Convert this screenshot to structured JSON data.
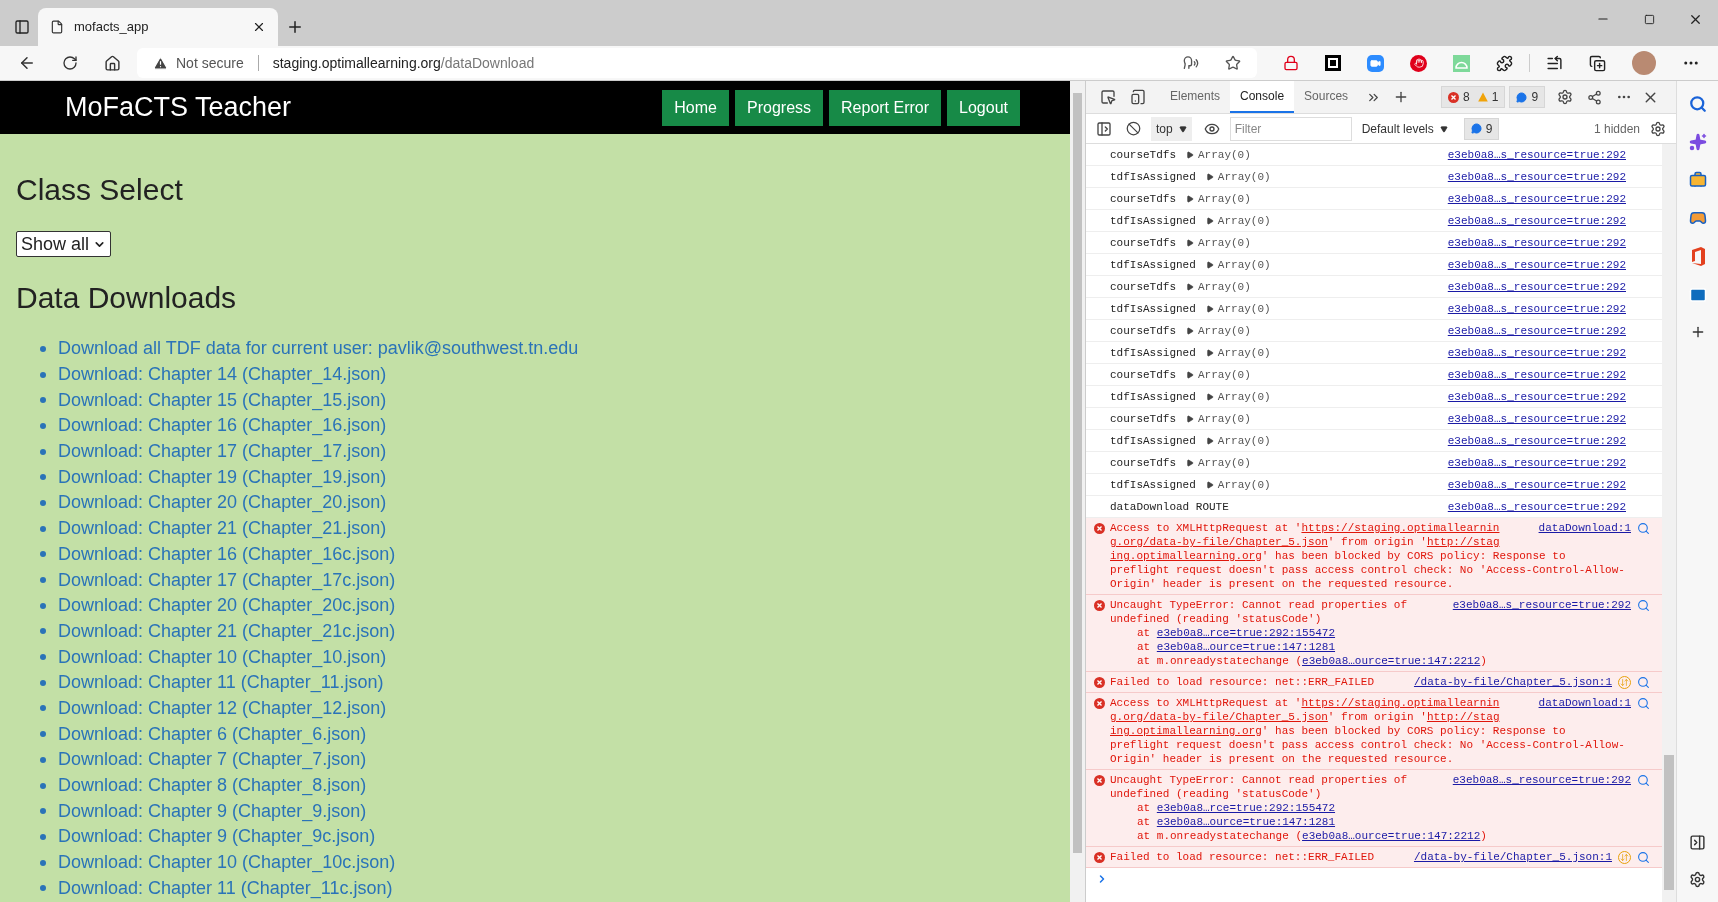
{
  "browser": {
    "tab": {
      "title": "mofacts_app",
      "selected": true
    },
    "address": {
      "security": "Not secure",
      "host": "staging.optimallearning.org",
      "path": "/dataDownload"
    }
  },
  "page": {
    "header": {
      "title": "MoFaCTS Teacher",
      "nav": [
        "Home",
        "Progress",
        "Report Error",
        "Logout"
      ]
    },
    "class_select": {
      "heading": "Class Select",
      "value": "Show all"
    },
    "downloads": {
      "heading": "Data Downloads",
      "links": [
        "Download all TDF data for current user: pavlik@southwest.tn.edu",
        "Download: Chapter 14 (Chapter_14.json)",
        "Download: Chapter 15 (Chapter_15.json)",
        "Download: Chapter 16 (Chapter_16.json)",
        "Download: Chapter 17 (Chapter_17.json)",
        "Download: Chapter 19 (Chapter_19.json)",
        "Download: Chapter 20 (Chapter_20.json)",
        "Download: Chapter 21 (Chapter_21.json)",
        "Download: Chapter 16 (Chapter_16c.json)",
        "Download: Chapter 17 (Chapter_17c.json)",
        "Download: Chapter 20 (Chapter_20c.json)",
        "Download: Chapter 21 (Chapter_21c.json)",
        "Download: Chapter 10 (Chapter_10.json)",
        "Download: Chapter 11 (Chapter_11.json)",
        "Download: Chapter 12 (Chapter_12.json)",
        "Download: Chapter 6 (Chapter_6.json)",
        "Download: Chapter 7 (Chapter_7.json)",
        "Download: Chapter 8 (Chapter_8.json)",
        "Download: Chapter 9 (Chapter_9.json)",
        "Download: Chapter 9 (Chapter_9c.json)",
        "Download: Chapter 10 (Chapter_10c.json)",
        "Download: Chapter 11 (Chapter_11c.json)"
      ]
    }
  },
  "devtools": {
    "tabs": [
      {
        "label": "Elements",
        "selected": false
      },
      {
        "label": "Console",
        "selected": true
      },
      {
        "label": "Sources",
        "selected": false
      }
    ],
    "error_count": "8",
    "warning_count": "1",
    "message_count": "9",
    "context": "top",
    "filter_placeholder": "Filter",
    "levels": "Default levels",
    "level_message_count": "9",
    "hidden": "1 hidden",
    "console": [
      {
        "kind": "log",
        "label": "courseTdfs",
        "value": "Array(0)",
        "source": "e3eb0a8…s_resource=true:292"
      },
      {
        "kind": "log",
        "label": "tdfIsAssigned",
        "value": "Array(0)",
        "source": "e3eb0a8…s_resource=true:292"
      },
      {
        "kind": "log",
        "label": "courseTdfs",
        "value": "Array(0)",
        "source": "e3eb0a8…s_resource=true:292"
      },
      {
        "kind": "log",
        "label": "tdfIsAssigned",
        "value": "Array(0)",
        "source": "e3eb0a8…s_resource=true:292"
      },
      {
        "kind": "log",
        "label": "courseTdfs",
        "value": "Array(0)",
        "source": "e3eb0a8…s_resource=true:292"
      },
      {
        "kind": "log",
        "label": "tdfIsAssigned",
        "value": "Array(0)",
        "source": "e3eb0a8…s_resource=true:292"
      },
      {
        "kind": "log",
        "label": "courseTdfs",
        "value": "Array(0)",
        "source": "e3eb0a8…s_resource=true:292"
      },
      {
        "kind": "log",
        "label": "tdfIsAssigned",
        "value": "Array(0)",
        "source": "e3eb0a8…s_resource=true:292"
      },
      {
        "kind": "log",
        "label": "courseTdfs",
        "value": "Array(0)",
        "source": "e3eb0a8…s_resource=true:292"
      },
      {
        "kind": "log",
        "label": "tdfIsAssigned",
        "value": "Array(0)",
        "source": "e3eb0a8…s_resource=true:292"
      },
      {
        "kind": "log",
        "label": "courseTdfs",
        "value": "Array(0)",
        "source": "e3eb0a8…s_resource=true:292"
      },
      {
        "kind": "log",
        "label": "tdfIsAssigned",
        "value": "Array(0)",
        "source": "e3eb0a8…s_resource=true:292"
      },
      {
        "kind": "log",
        "label": "courseTdfs",
        "value": "Array(0)",
        "source": "e3eb0a8…s_resource=true:292"
      },
      {
        "kind": "log",
        "label": "tdfIsAssigned",
        "value": "Array(0)",
        "source": "e3eb0a8…s_resource=true:292"
      },
      {
        "kind": "log",
        "label": "courseTdfs",
        "value": "Array(0)",
        "source": "e3eb0a8…s_resource=true:292"
      },
      {
        "kind": "log",
        "label": "tdfIsAssigned",
        "value": "Array(0)",
        "source": "e3eb0a8…s_resource=true:292"
      },
      {
        "kind": "text",
        "label": "dataDownload ROUTE",
        "source": "e3eb0a8…s_resource=true:292"
      },
      {
        "kind": "error",
        "lines": [
          [
            {
              "text": "Access to XMLHttpRequest at '",
              "link": false
            },
            {
              "text": "https://staging.optimallearnin",
              "link": true
            }
          ],
          [
            {
              "text": "g.org/data-by-file/Chapter_5.json",
              "link": true
            },
            {
              "text": "' from origin '",
              "link": false
            },
            {
              "text": "http://stag",
              "link": true
            }
          ],
          [
            {
              "text": "ing.optimallearning.org",
              "link": true
            },
            {
              "text": "' has been blocked by CORS policy: Response to",
              "link": false
            }
          ],
          [
            {
              "text": "preflight request doesn't pass access control check: No 'Access-Control-Allow-",
              "link": false
            }
          ],
          [
            {
              "text": "Origin' header is present on the requested resource.",
              "link": false
            }
          ]
        ],
        "source": "dataDownload:1",
        "network": false
      },
      {
        "kind": "error",
        "lines": [
          [
            {
              "text": "Uncaught TypeError: Cannot read properties of",
              "link": false
            }
          ],
          [
            {
              "text": "undefined (reading 'statusCode')",
              "link": false
            }
          ]
        ],
        "stack": [
          [
            {
              "text": "at ",
              "link": false
            },
            {
              "text": "e3eb0a8…rce=true:292:155472",
              "link": true
            }
          ],
          [
            {
              "text": "at ",
              "link": false
            },
            {
              "text": "e3eb0a8…ource=true:147:1281",
              "link": true
            }
          ],
          [
            {
              "text": "at m.onreadystatechange (",
              "link": false
            },
            {
              "text": "e3eb0a8…ource=true:147:2212",
              "link": true
            },
            {
              "text": ")",
              "link": false
            }
          ]
        ],
        "source": "e3eb0a8…s_resource=true:292",
        "network": false
      },
      {
        "kind": "error",
        "lines": [
          [
            {
              "text": "Failed to load resource: net::ERR_FAILED",
              "link": false
            }
          ]
        ],
        "source": "/data-by-file/Chapter_5.json:1",
        "network": true
      },
      {
        "kind": "error",
        "lines": [
          [
            {
              "text": "Access to XMLHttpRequest at '",
              "link": false
            },
            {
              "text": "https://staging.optimallearnin",
              "link": true
            }
          ],
          [
            {
              "text": "g.org/data-by-file/Chapter_5.json",
              "link": true
            },
            {
              "text": "' from origin '",
              "link": false
            },
            {
              "text": "http://stag",
              "link": true
            }
          ],
          [
            {
              "text": "ing.optimallearning.org",
              "link": true
            },
            {
              "text": "' has been blocked by CORS policy: Response to",
              "link": false
            }
          ],
          [
            {
              "text": "preflight request doesn't pass access control check: No 'Access-Control-Allow-",
              "link": false
            }
          ],
          [
            {
              "text": "Origin' header is present on the requested resource.",
              "link": false
            }
          ]
        ],
        "source": "dataDownload:1",
        "network": false
      },
      {
        "kind": "error",
        "lines": [
          [
            {
              "text": "Uncaught TypeError: Cannot read properties of",
              "link": false
            }
          ],
          [
            {
              "text": "undefined (reading 'statusCode')",
              "link": false
            }
          ]
        ],
        "stack": [
          [
            {
              "text": "at ",
              "link": false
            },
            {
              "text": "e3eb0a8…rce=true:292:155472",
              "link": true
            }
          ],
          [
            {
              "text": "at ",
              "link": false
            },
            {
              "text": "e3eb0a8…ource=true:147:1281",
              "link": true
            }
          ],
          [
            {
              "text": "at m.onreadystatechange (",
              "link": false
            },
            {
              "text": "e3eb0a8…ource=true:147:2212",
              "link": true
            },
            {
              "text": ")",
              "link": false
            }
          ]
        ],
        "source": "e3eb0a8…s_resource=true:292",
        "network": false
      },
      {
        "kind": "error",
        "lines": [
          [
            {
              "text": "Failed to load resource: net::ERR_FAILED",
              "link": false
            }
          ]
        ],
        "source": "/data-by-file/Chapter_5.json:1",
        "network": true
      }
    ]
  }
}
